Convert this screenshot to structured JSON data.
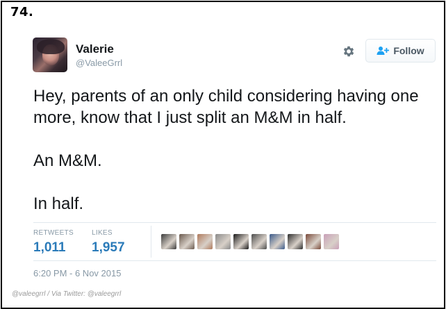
{
  "list_number": "74.",
  "user": {
    "display_name": "Valerie",
    "handle": "@ValeeGrrl"
  },
  "actions": {
    "settings_icon": "gear-icon",
    "follow_label": "Follow",
    "follow_icon": "add-user-icon"
  },
  "tweet": {
    "lines": [
      "Hey, parents of an only child considering having one more, know that I just split an M&M in half.",
      "An M&M.",
      "In half."
    ]
  },
  "stats": {
    "retweets_label": "RETWEETS",
    "retweets_value": "1,011",
    "likes_label": "LIKES",
    "likes_value": "1,957"
  },
  "likers": [
    {
      "name": "liker-1",
      "color": "#3b3b3b"
    },
    {
      "name": "liker-2",
      "color": "#6b5a4e"
    },
    {
      "name": "liker-3",
      "color": "#b07a5c"
    },
    {
      "name": "liker-4",
      "color": "#8a8a8a"
    },
    {
      "name": "liker-5",
      "color": "#1a1a1a"
    },
    {
      "name": "liker-6",
      "color": "#4d4d4d"
    },
    {
      "name": "liker-7",
      "color": "#3a5a8a"
    },
    {
      "name": "liker-8",
      "color": "#2e2e2e"
    },
    {
      "name": "liker-9",
      "color": "#7a4a3a"
    },
    {
      "name": "liker-10",
      "color": "#c9a0b8"
    }
  ],
  "timestamp": "6:20 PM - 6 Nov 2015",
  "credit": "@valeegrrl / Via Twitter: @valeegrrl",
  "colors": {
    "link_blue": "#2b7bb9",
    "text": "#14171a",
    "muted": "#8899a6",
    "border": "#e1e8ed"
  }
}
